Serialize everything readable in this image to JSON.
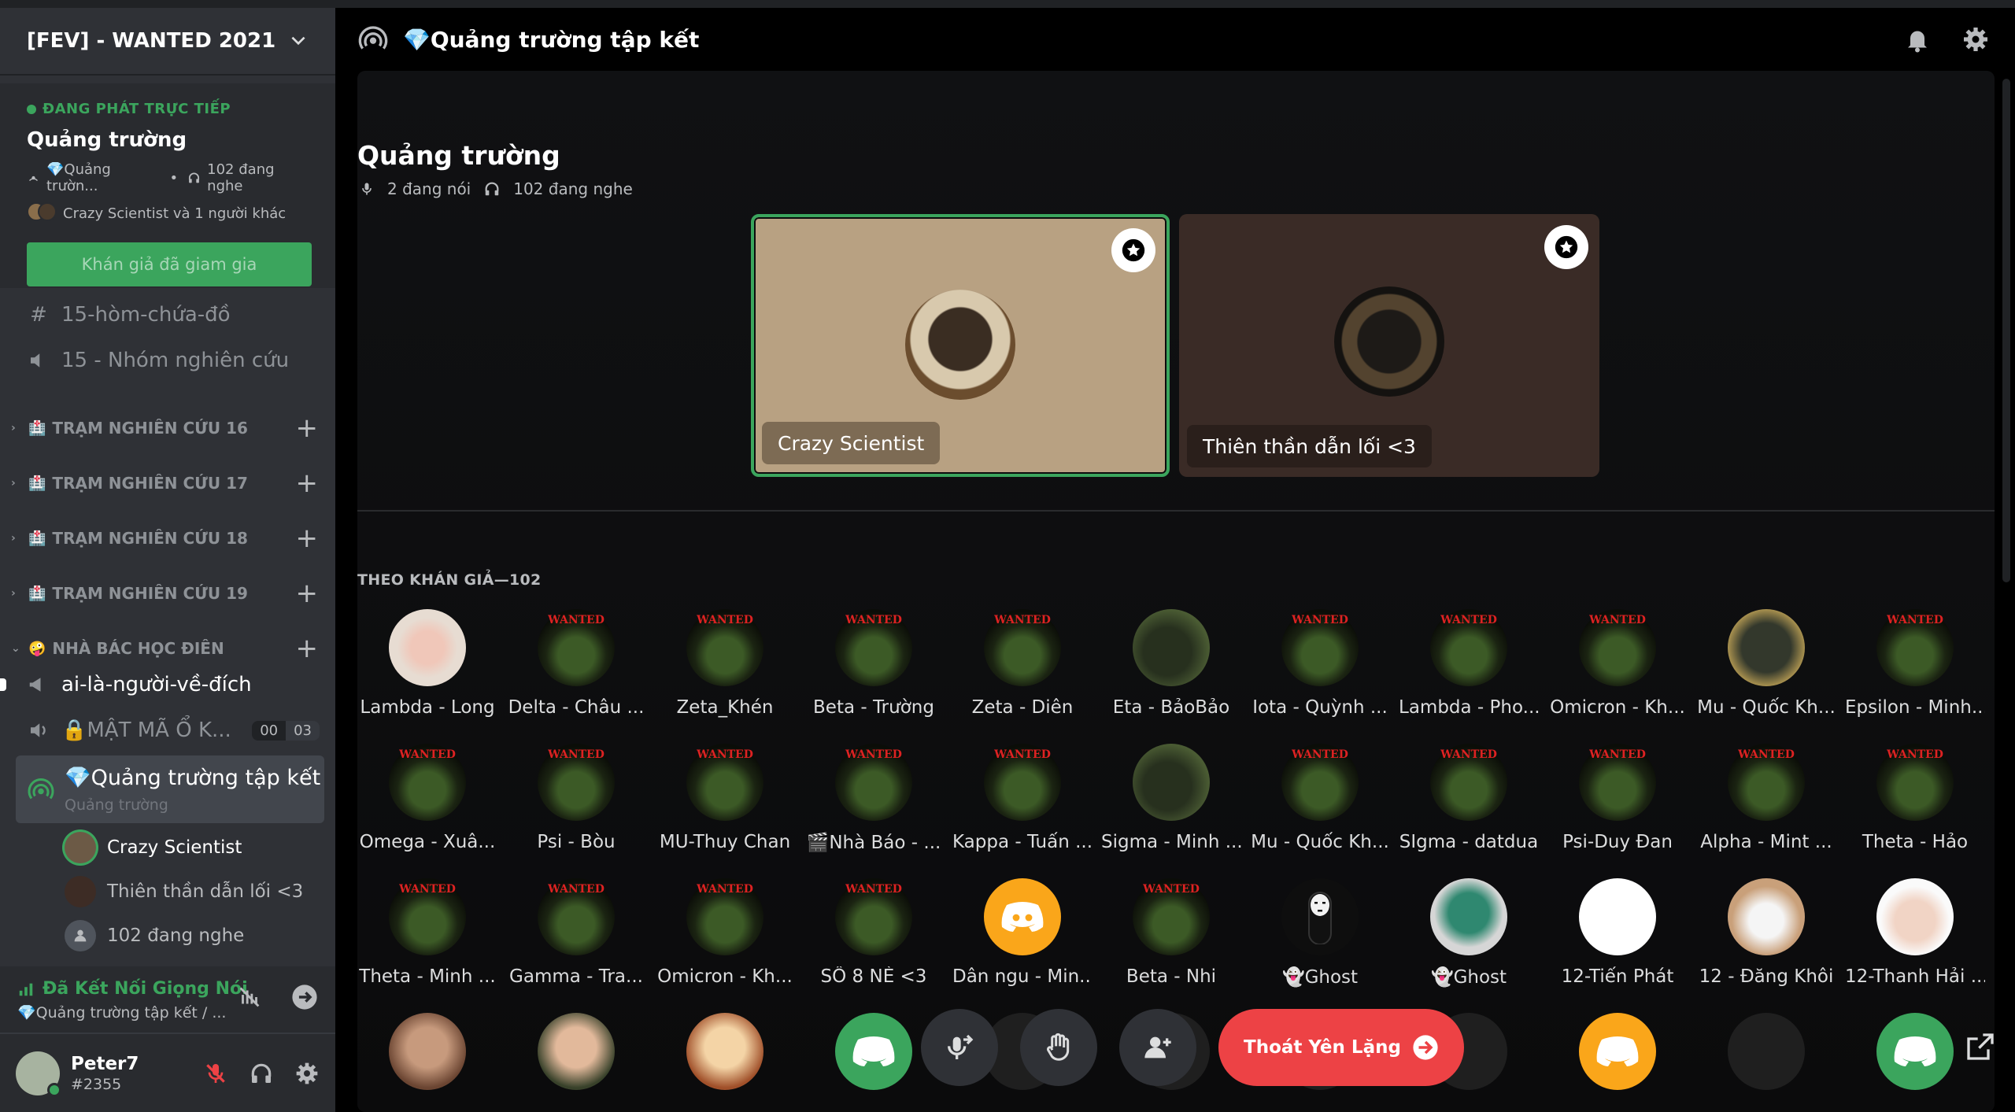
{
  "server": {
    "name": "[FEV] - WANTED 2021"
  },
  "live": {
    "label": "ĐANG PHÁT TRỰC TIẾP",
    "title": "Quảng trường",
    "channel_short": "💎Quảng trườn...",
    "listeners": "102 đang nghe",
    "speakers_summary": "Crazy Scientist và 1 người khác",
    "button": "Khán giả đã giam gia"
  },
  "channels": {
    "text1": "15-hòm-chứa-đồ",
    "voice1": "15 - Nhóm nghiên cứu",
    "categories": [
      "TRẠM NGHIÊN CỨU 16",
      "TRẠM NGHIÊN CỨU 17",
      "TRẠM NGHIÊN CỨU 18",
      "TRẠM NGHIÊN CỨU 19",
      "NHÀ BÁC HỌC ĐIÊN"
    ],
    "announce": "ai-là-người-về-đích",
    "locked": "🔒MẬT MÃ Ổ K...",
    "locked_count_a": "00",
    "locked_count_b": "03",
    "stage_name": "💎Quảng trường tập kết",
    "stage_sub": "Quảng trường",
    "voice_users": [
      "Crazy Scientist",
      "Thiên thần dẫn lối <3",
      "102 đang nghe"
    ]
  },
  "voice_panel": {
    "status": "Đã Kết Nối Giọng Nói",
    "channel": "💎Quảng trường tập kết / ..."
  },
  "user": {
    "name": "Peter7",
    "tag": "#2355"
  },
  "header": {
    "title": "💎Quảng trường tập kết"
  },
  "stage": {
    "title": "Quảng trường",
    "speaking": "2 đang nói",
    "listening": "102 đang nghe",
    "speakers": [
      "Crazy Scientist",
      "Thiên thần dẫn lối <3"
    ],
    "audience_header": "THEO KHÁN GIẢ—102"
  },
  "audience": [
    "Lambda - Long",
    "Delta - Châu ...",
    "Zeta_Khén",
    "Beta - Trường",
    "Zeta - Diên",
    "Eta - BảoBảo",
    "Iota - Quỳnh ...",
    "Lambda - Pho...",
    "Omicron - Kh...",
    "Mu - Quốc Kh...",
    "Epsilon - Minh...",
    "Omega - Xuâ...",
    "Psi - Bòu",
    "MU-Thuy Chan",
    "🎬Nhà Báo - ...",
    "Kappa - Tuấn ...",
    "Sigma - Minh ...",
    "Mu - Quốc Kh...",
    "SIgma - datdua",
    "Psi-Duy Đan",
    "Alpha - Mint ...",
    "Theta - Hảo",
    "Theta - Minh ...",
    "Gamma - Tra...",
    "Omicron - Kh...",
    "SỐ 8 NÈ <3",
    "Dân ngu - Min...",
    "Beta - Nhi",
    "👻Ghost",
    "👻Ghost",
    "12-Tiến Phát",
    "12 - Đăng Khôi",
    "12-Thanh Hải ..."
  ],
  "controls": {
    "leave": "Thoát Yên Lặng"
  },
  "colors": {
    "accent_green": "#3ba55d",
    "danger": "#ed4245",
    "sidebar": "#2f3136"
  }
}
